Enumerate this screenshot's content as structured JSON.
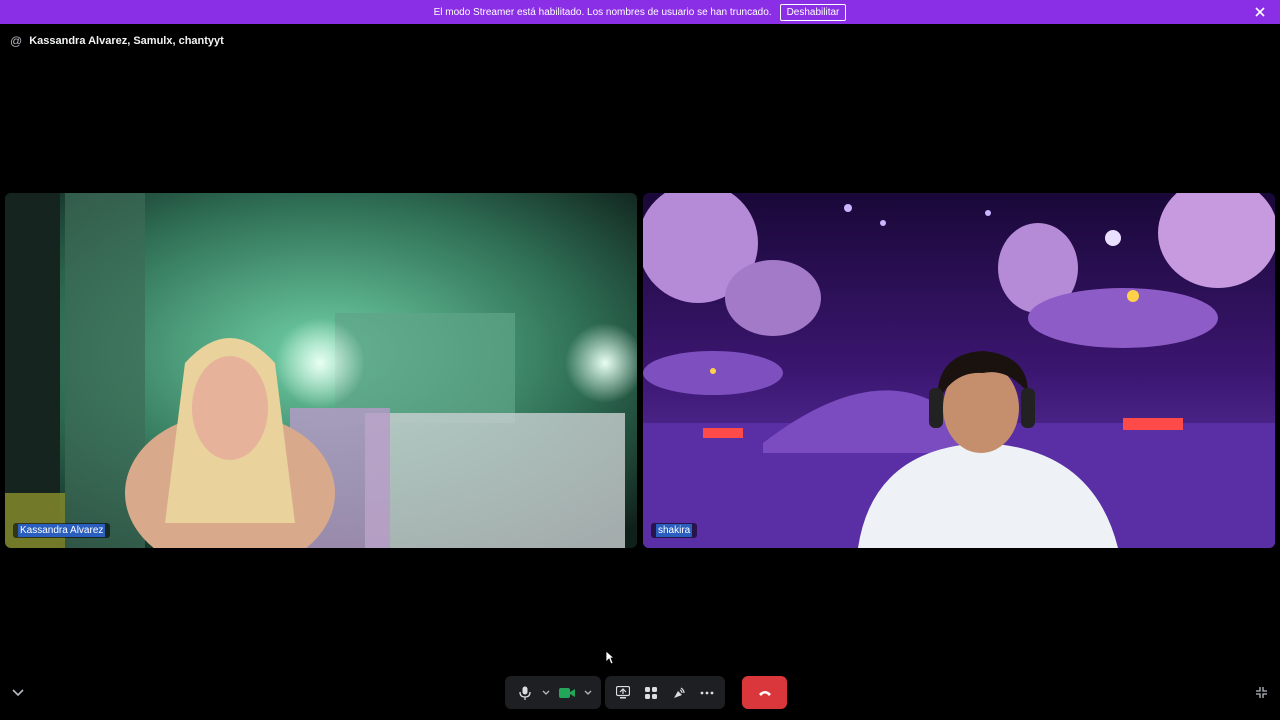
{
  "banner": {
    "message": "El modo Streamer está habilitado. Los nombres de usuario se han truncado.",
    "disable_label": "Deshabilitar",
    "color": "#8a2fe6"
  },
  "header": {
    "icon": "at-icon",
    "title": "Kassandra Alvarez, Samulx, chantyyt"
  },
  "participants": [
    {
      "name": "Kassandra Alvarez",
      "tile_tone": "#6fbf9a"
    },
    {
      "name": "shakira",
      "tile_tone": "#7a3fd0"
    }
  ],
  "controls": {
    "mic_icon": "microphone-icon",
    "camera_icon": "camera-icon",
    "screen_share_icon": "screen-share-icon",
    "activities_icon": "activities-icon",
    "soundboard_icon": "soundboard-icon",
    "more_icon": "more-icon",
    "hangup_icon": "phone-hangup-icon",
    "hangup_color": "#da373c",
    "camera_color": "#23a55a"
  }
}
